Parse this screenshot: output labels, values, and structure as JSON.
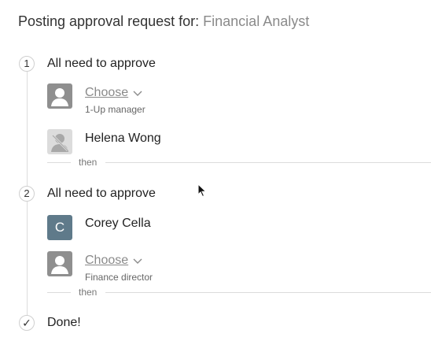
{
  "header": {
    "prefix": "Posting approval request for:",
    "job_title": "Financial Analyst"
  },
  "steps": [
    {
      "number": "1",
      "title": "All need to approve",
      "approvers": [
        {
          "type": "choose",
          "label": "Choose",
          "role": "1-Up manager",
          "icon": "user-placeholder-icon"
        },
        {
          "type": "person",
          "name": "Helena Wong",
          "icon": "user-disabled-icon"
        }
      ],
      "separator": "then"
    },
    {
      "number": "2",
      "title": "All need to approve",
      "approvers": [
        {
          "type": "person",
          "name": "Corey Cella",
          "initial": "C"
        },
        {
          "type": "choose",
          "label": "Choose",
          "role": "Finance director",
          "icon": "user-placeholder-icon"
        }
      ],
      "separator": "then"
    }
  ],
  "final": {
    "icon": "checkmark-icon",
    "mark": "✓",
    "label": "Done!"
  },
  "colors": {
    "avatar_placeholder": "#8f8f8f",
    "avatar_disabled": "#dcdcdc",
    "avatar_initial": "#5f7a8a",
    "rail": "#dcdcdc"
  }
}
